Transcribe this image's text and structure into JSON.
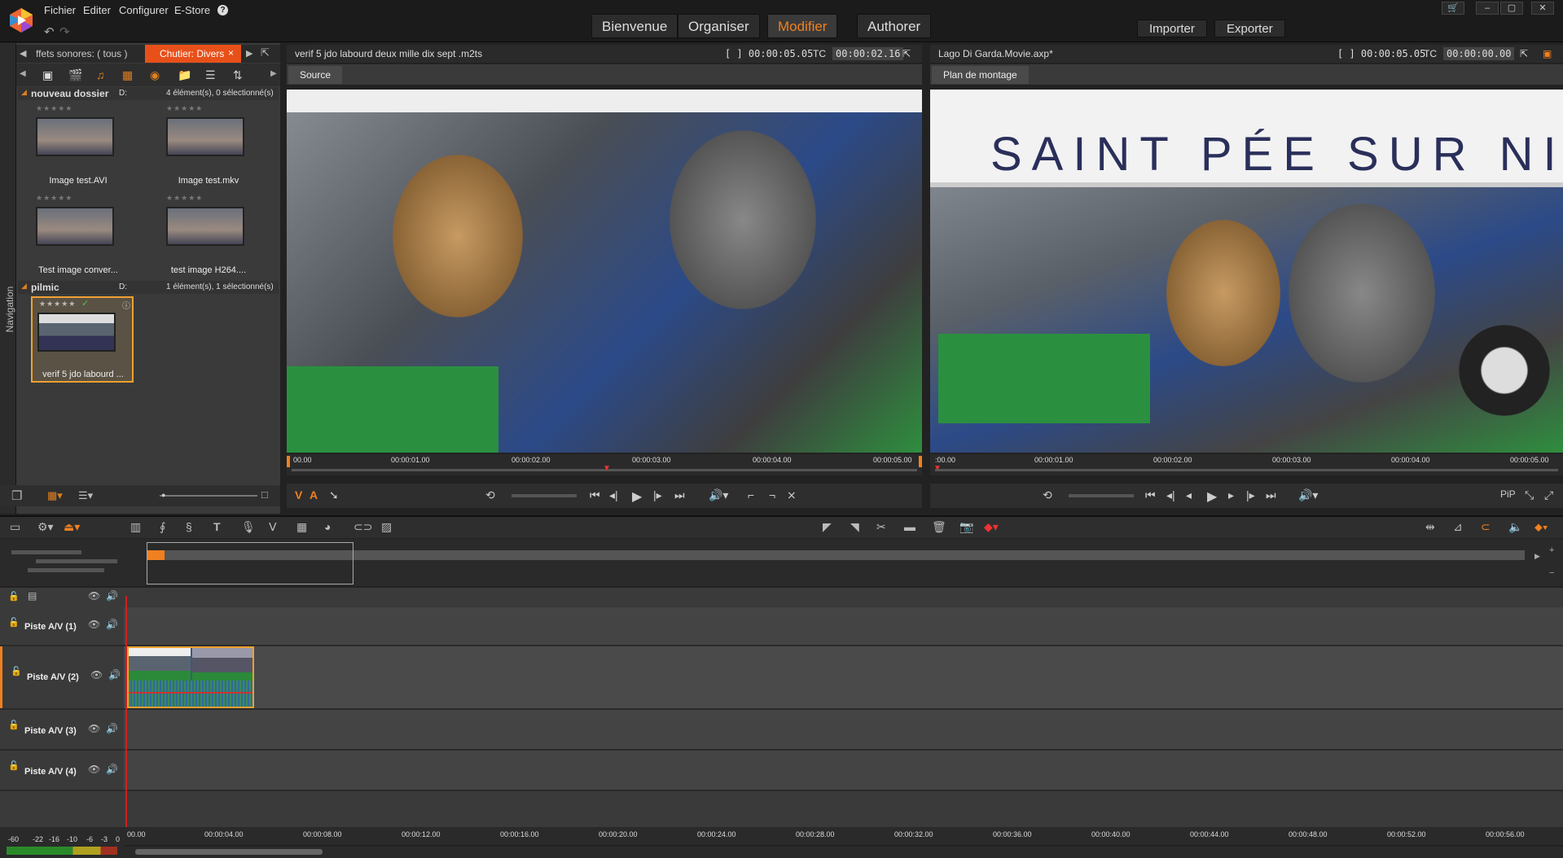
{
  "menu": {
    "file": "Fichier",
    "edit": "Editer",
    "configure": "Configurer",
    "estore": "E-Store",
    "help": "?"
  },
  "main_tabs": [
    {
      "label": "Bienvenue"
    },
    {
      "label": "Organiser"
    },
    {
      "label": "Modifier",
      "active": true
    },
    {
      "label": "Authorer"
    }
  ],
  "top_buttons": {
    "import": "Importer",
    "export": "Exporter"
  },
  "library": {
    "tab_sound": "ffets sonores: ( tous )",
    "tab_bin": "Chutier: Divers",
    "nav_label": "Navigation",
    "folders": [
      {
        "name": "nouveau dossier",
        "drive": "D:",
        "status": "4 élément(s), 0 sélectionné(s)",
        "items": [
          {
            "caption": "Image test.AVI"
          },
          {
            "caption": "Image test.mkv"
          },
          {
            "caption": "Test image conver..."
          },
          {
            "caption": "test image H264...."
          }
        ]
      },
      {
        "name": "pilmic",
        "drive": "D:",
        "status": "1 élément(s), 1 sélectionné(s)",
        "items": [
          {
            "caption": "verif 5 jdo labourd ...",
            "selected": true
          }
        ]
      }
    ]
  },
  "source": {
    "title": "verif 5 jdo labourd deux mille dix sept .m2ts",
    "duration": "[ ] 00:00:05.05",
    "tc_label": "TC",
    "tc": "00:00:02.16",
    "tab": "Source",
    "ruler": [
      "00.00",
      "00:00:01.00",
      "00:00:02.00",
      "00:00:03.00",
      "00:00:04.00",
      "00:00:05.00"
    ]
  },
  "program": {
    "title": "Lago Di Garda.Movie.axp*",
    "duration": "[ ] 00:00:05.05",
    "tc_label": "TC",
    "tc": "00:00:00.00",
    "tab": "Plan de montage",
    "pip": "PiP",
    "ruler": [
      ":00.00",
      "00:00:01.00",
      "00:00:02.00",
      "00:00:03.00",
      "00:00:04.00",
      "00:00:05.00"
    ]
  },
  "video_text": {
    "banner": "SAINT PÉE SUR NI"
  },
  "tracks": [
    {
      "label": "Piste A/V (1)"
    },
    {
      "label": "Piste A/V (2)"
    },
    {
      "label": "Piste A/V (3)"
    },
    {
      "label": "Piste A/V (4)"
    }
  ],
  "timeline_ruler": [
    "00.00",
    "00:00:04.00",
    "00:00:08.00",
    "00:00:12.00",
    "00:00:16.00",
    "00:00:20.00",
    "00:00:24.00",
    "00:00:28.00",
    "00:00:32.00",
    "00:00:36.00",
    "00:00:40.00",
    "00:00:44.00",
    "00:00:48.00",
    "00:00:52.00",
    "00:00:56.00"
  ],
  "vu_scale": [
    "-60",
    "-22",
    "-16",
    "-10",
    "-6",
    "-3",
    "0"
  ],
  "colors": {
    "accent": "#f08020",
    "bin_tab": "#e8501a",
    "selection": "#f0a030",
    "playhead": "#d02020"
  }
}
